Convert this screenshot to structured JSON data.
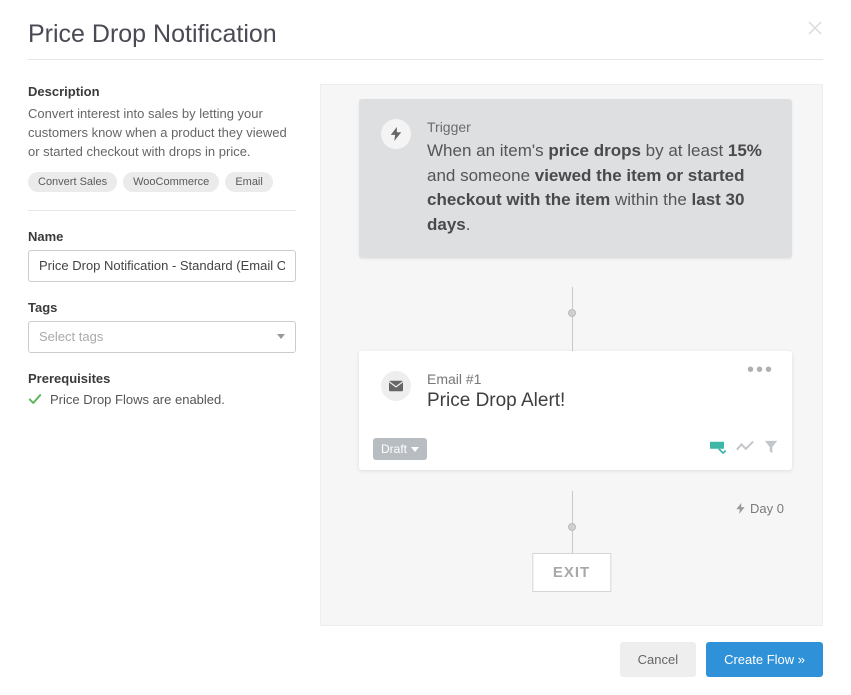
{
  "modal": {
    "title": "Price Drop Notification"
  },
  "left": {
    "description_heading": "Description",
    "description_text": "Convert interest into sales by letting your customers know when a product they viewed or started checkout with drops in price.",
    "tags": [
      "Convert Sales",
      "WooCommerce",
      "Email"
    ],
    "name_heading": "Name",
    "name_value": "Price Drop Notification - Standard (Email Only)",
    "tags_heading": "Tags",
    "tags_placeholder": "Select tags",
    "prereq_heading": "Prerequisites",
    "prereq_item": "Price Drop Flows are enabled."
  },
  "flow": {
    "trigger": {
      "label": "Trigger",
      "text_parts": {
        "p1": "When an item's ",
        "b1": "price drops",
        "p2": " by at least ",
        "b2": "15%",
        "p3": " and someone ",
        "b3": "viewed the item or started checkout with the item",
        "p4": " within the ",
        "b4": "last 30 days",
        "p5": "."
      }
    },
    "email": {
      "label": "Email #1",
      "subject": "Price Drop Alert!",
      "status": "Draft",
      "timing": "Day 0"
    },
    "exit": "EXIT"
  },
  "footer": {
    "cancel": "Cancel",
    "create": "Create Flow »"
  }
}
